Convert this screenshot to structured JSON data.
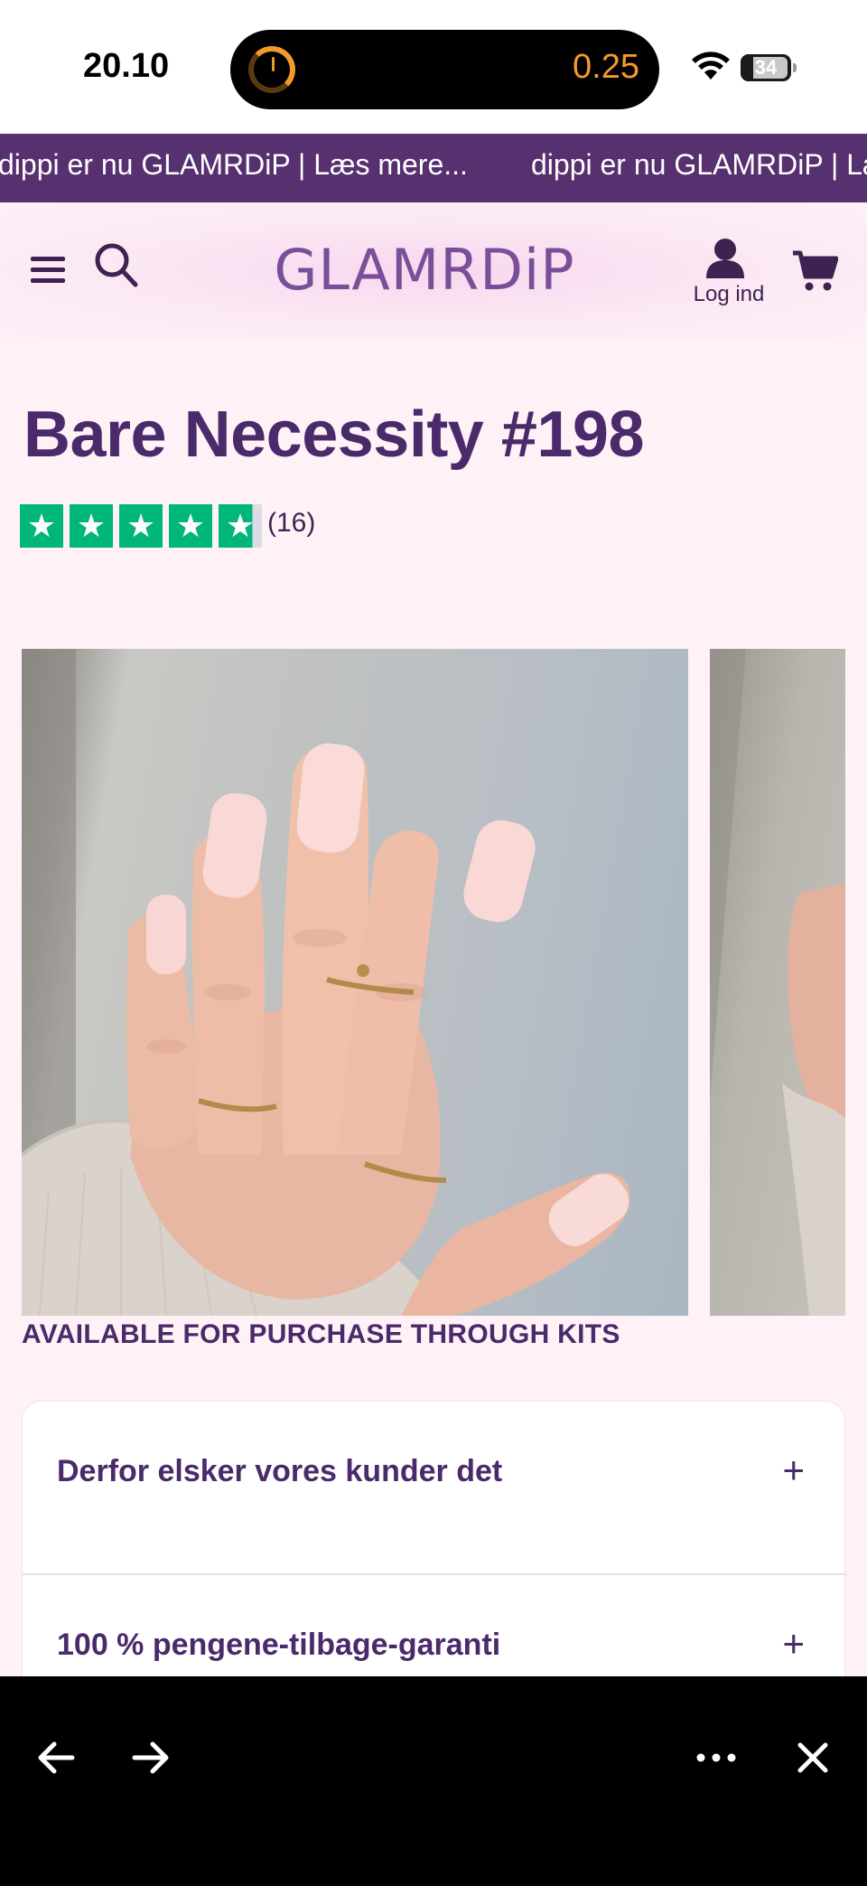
{
  "status_bar": {
    "time": "20.10",
    "timer_value": "0.25",
    "battery": "34"
  },
  "announcement": {
    "text_1": "dippi er nu GLAMRDiP | Læs mere...",
    "text_2": "dippi er nu GLAMRDiP | Læs mere..."
  },
  "header": {
    "logo": "GLAMRDiP",
    "account_label": "Log ind"
  },
  "product": {
    "title": "Bare Necessity #198",
    "rating_stars": 4.8,
    "review_count": "(16)",
    "availability": "AVAILABLE FOR PURCHASE THROUGH KITS"
  },
  "accordion": {
    "items": [
      {
        "title": "Derfor elsker vores kunder det"
      },
      {
        "title": "100 % pengene-tilbage-garanti"
      }
    ]
  },
  "colors": {
    "brand_purple": "#56306f",
    "trustpilot_green": "#00b67a",
    "page_bg": "#fff2f7"
  },
  "icons": {
    "back": "arrow-left-icon",
    "forward": "arrow-right-icon",
    "more": "more-icon",
    "close": "close-icon"
  }
}
